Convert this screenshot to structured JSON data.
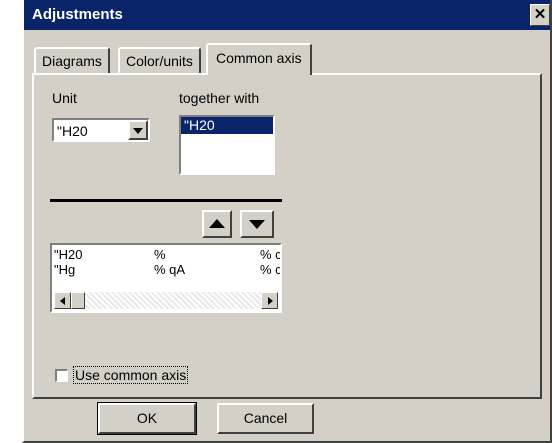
{
  "window": {
    "title": "Adjustments",
    "close_glyph": "✕"
  },
  "tabs": [
    {
      "label": "Diagrams",
      "active": false
    },
    {
      "label": "Color/units",
      "active": false
    },
    {
      "label": "Common axis",
      "active": true
    }
  ],
  "unit": {
    "label": "Unit",
    "selected": "\"H20"
  },
  "together_with": {
    "label": "together with",
    "items": [
      "\"H20"
    ],
    "selected_index": 0
  },
  "unit_table": {
    "rows": [
      [
        "\"H20",
        "%",
        "% c"
      ],
      [
        "\"Hg",
        "% qA",
        "% c"
      ]
    ]
  },
  "move_buttons": {
    "up_icon": "triangle-up-icon",
    "down_icon": "triangle-down-icon"
  },
  "checkbox": {
    "label": "Use common axis",
    "checked": false
  },
  "buttons": {
    "ok": "OK",
    "cancel": "Cancel"
  },
  "colors": {
    "titlebar": "#0a246a",
    "selection": "#0a246a",
    "face": "#d4d0c8"
  }
}
